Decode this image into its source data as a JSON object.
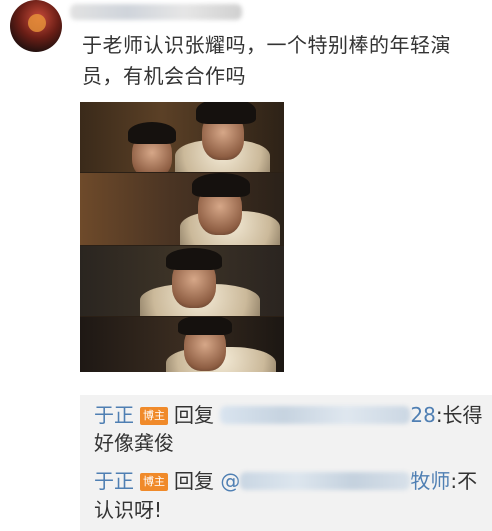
{
  "post": {
    "text": "于老师认识张耀吗，一个特别棒的年轻演员，有机会合作吗"
  },
  "replies": [
    {
      "author": "于正",
      "badge": "博主",
      "reply_word": "回复",
      "target_visible_suffix": "28",
      "text_line1": ":长得",
      "text_line2": "好像龚俊"
    },
    {
      "author": "于正",
      "badge": "博主",
      "reply_word": "回复",
      "mention_prefix": "@",
      "target_visible_suffix": "牧师",
      "text_line1": ":不",
      "text_line2": "认识呀!"
    }
  ],
  "colors": {
    "link_blue": "#4f7fb3",
    "badge_orange": "#f08a2a",
    "reply_bg": "#f2f2f2"
  }
}
